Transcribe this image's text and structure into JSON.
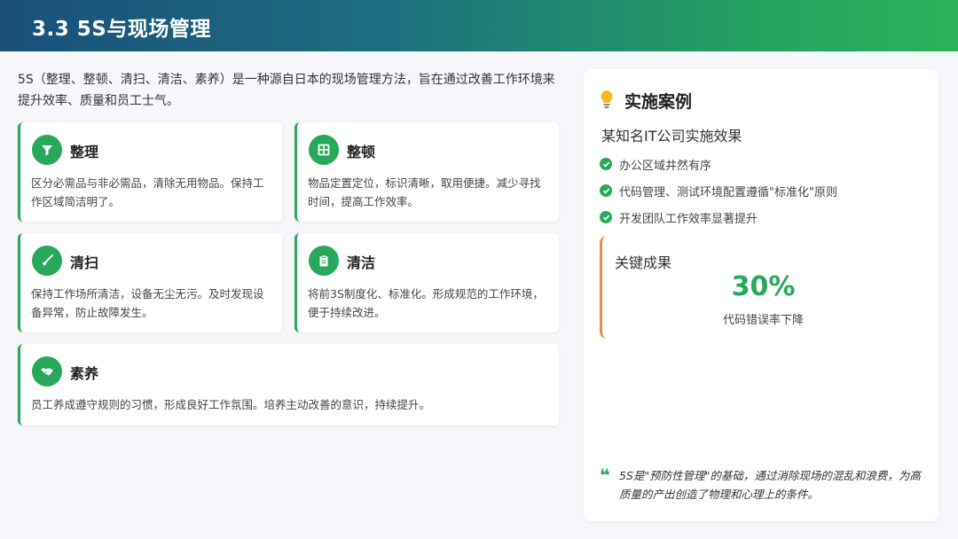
{
  "header": {
    "title": "3.3 5S与现场管理"
  },
  "intro": "5S（整理、整顿、清扫、清洁、素养）是一种源自日本的现场管理方法，旨在通过改善工作环境来提升效率、质量和员工士气。",
  "cards": [
    {
      "icon": "filter-icon",
      "title": "整理",
      "desc": "区分必需品与非必需品，清除无用物品。保持工作区域简洁明了。"
    },
    {
      "icon": "grid-icon",
      "title": "整顿",
      "desc": "物品定置定位，标识清晰，取用便捷。减少寻找时间，提高工作效率。"
    },
    {
      "icon": "broom-icon",
      "title": "清扫",
      "desc": "保持工作场所清洁，设备无尘无污。及时发现设备异常，防止故障发生。"
    },
    {
      "icon": "clipboard-icon",
      "title": "清洁",
      "desc": "将前3S制度化、标准化。形成规范的工作环境，便于持续改进。"
    },
    {
      "icon": "handshake-icon",
      "title": "素养",
      "desc": "员工养成遵守规则的习惯，形成良好工作氛围。培养主动改善的意识，持续提升。"
    }
  ],
  "side": {
    "title": "实施案例",
    "subtitle": "某知名IT公司实施效果",
    "items": [
      "办公区域井然有序",
      "代码管理、测试环境配置遵循\"标准化\"原则",
      "开发团队工作效率显著提升"
    ],
    "result": {
      "label": "关键成果",
      "value": "30%",
      "desc": "代码错误率下降"
    },
    "quote_mark": "❝",
    "quote": "5S是\"预防性管理\"的基础，通过消除现场的混乱和浪费，为高质量的产出创造了物理和心理上的条件。"
  },
  "colors": {
    "accent": "#28a85a",
    "highlight": "#f08a3c",
    "header_start": "#1a4f7a",
    "header_end": "#2bb35a"
  }
}
